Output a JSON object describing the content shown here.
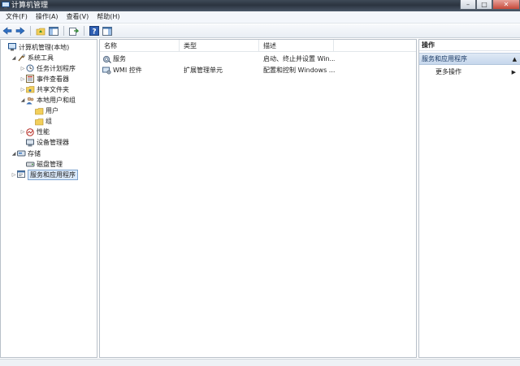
{
  "window": {
    "title": "计算机管理",
    "controls": {
      "minimize": "–",
      "maximize": "□",
      "close": "✕"
    }
  },
  "menu": [
    {
      "label": "文件(F)"
    },
    {
      "label": "操作(A)"
    },
    {
      "label": "查看(V)"
    },
    {
      "label": "帮助(H)"
    }
  ],
  "tree": [
    {
      "label": "计算机管理(本地)",
      "depth": 0,
      "arrow": "",
      "icon": "computer-management-icon"
    },
    {
      "label": "系统工具",
      "depth": 1,
      "arrow": "◢",
      "icon": "system-tools-icon"
    },
    {
      "label": "任务计划程序",
      "depth": 2,
      "arrow": "▷",
      "icon": "task-scheduler-icon"
    },
    {
      "label": "事件查看器",
      "depth": 2,
      "arrow": "▷",
      "icon": "event-viewer-icon"
    },
    {
      "label": "共享文件夹",
      "depth": 2,
      "arrow": "▷",
      "icon": "shared-folders-icon"
    },
    {
      "label": "本地用户和组",
      "depth": 2,
      "arrow": "◢",
      "icon": "local-users-groups-icon"
    },
    {
      "label": "用户",
      "depth": 3,
      "arrow": "",
      "icon": "folder-icon"
    },
    {
      "label": "组",
      "depth": 3,
      "arrow": "",
      "icon": "folder-icon"
    },
    {
      "label": "性能",
      "depth": 2,
      "arrow": "▷",
      "icon": "performance-icon"
    },
    {
      "label": "设备管理器",
      "depth": 2,
      "arrow": "",
      "icon": "device-manager-icon"
    },
    {
      "label": "存储",
      "depth": 1,
      "arrow": "◢",
      "icon": "storage-icon"
    },
    {
      "label": "磁盘管理",
      "depth": 2,
      "arrow": "",
      "icon": "disk-management-icon"
    },
    {
      "label": "服务和应用程序",
      "depth": 1,
      "arrow": "▷",
      "icon": "services-applications-icon",
      "selected": true
    }
  ],
  "list": {
    "columns": [
      "名称",
      "类型",
      "描述"
    ],
    "rows": [
      {
        "name": "服务",
        "type": "",
        "desc": "启动、终止并设置 Win...",
        "icon": "services-icon"
      },
      {
        "name": "WMI 控件",
        "type": "扩展管理单元",
        "desc": "配置和控制 Windows ...",
        "icon": "wmi-control-icon"
      }
    ]
  },
  "actions": {
    "header": "操作",
    "group": "服务和应用程序",
    "item": "更多操作"
  },
  "colors": {
    "selection": "#dcebfc",
    "action_group": "#c6d7ec",
    "titlebar": "#2b3440"
  }
}
